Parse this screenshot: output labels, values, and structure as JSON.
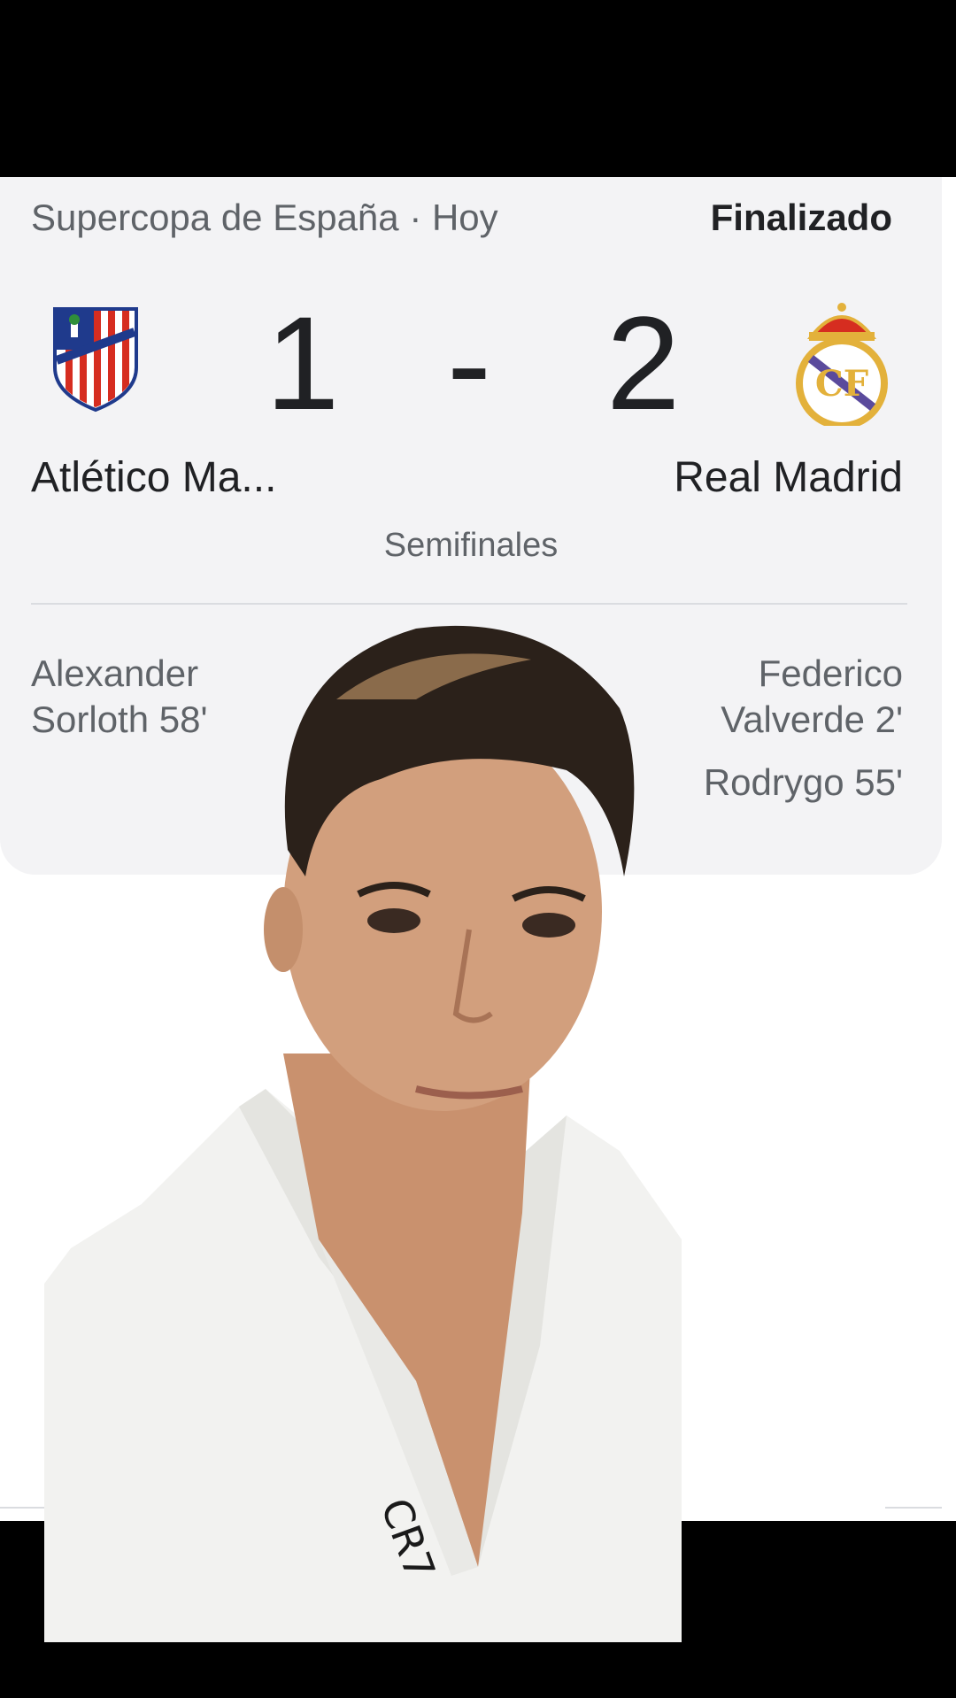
{
  "match": {
    "competition": "Supercopa de España · Hoy",
    "status": "Finalizado",
    "home_team": "Atlético Ma...",
    "away_team": "Real Madrid",
    "home_score": "1",
    "separator": "-",
    "away_score": "2",
    "stage": "Semifinales"
  },
  "scorers": {
    "home": [
      "Alexander\nSorloth 58'"
    ],
    "away": [
      "Federico\nValverde 2'",
      "Rodrygo 55'"
    ]
  },
  "overlay": {
    "robe_text": "CR7"
  },
  "colors": {
    "card_bg": "#f3f3f5",
    "text_primary": "#202124",
    "text_secondary": "#5f6368",
    "atletico_red": "#d62d20",
    "atletico_blue": "#1f3a8c",
    "real_gold": "#e3b13b"
  },
  "icons": [
    "atletico-crest-icon",
    "real-madrid-crest-icon"
  ]
}
